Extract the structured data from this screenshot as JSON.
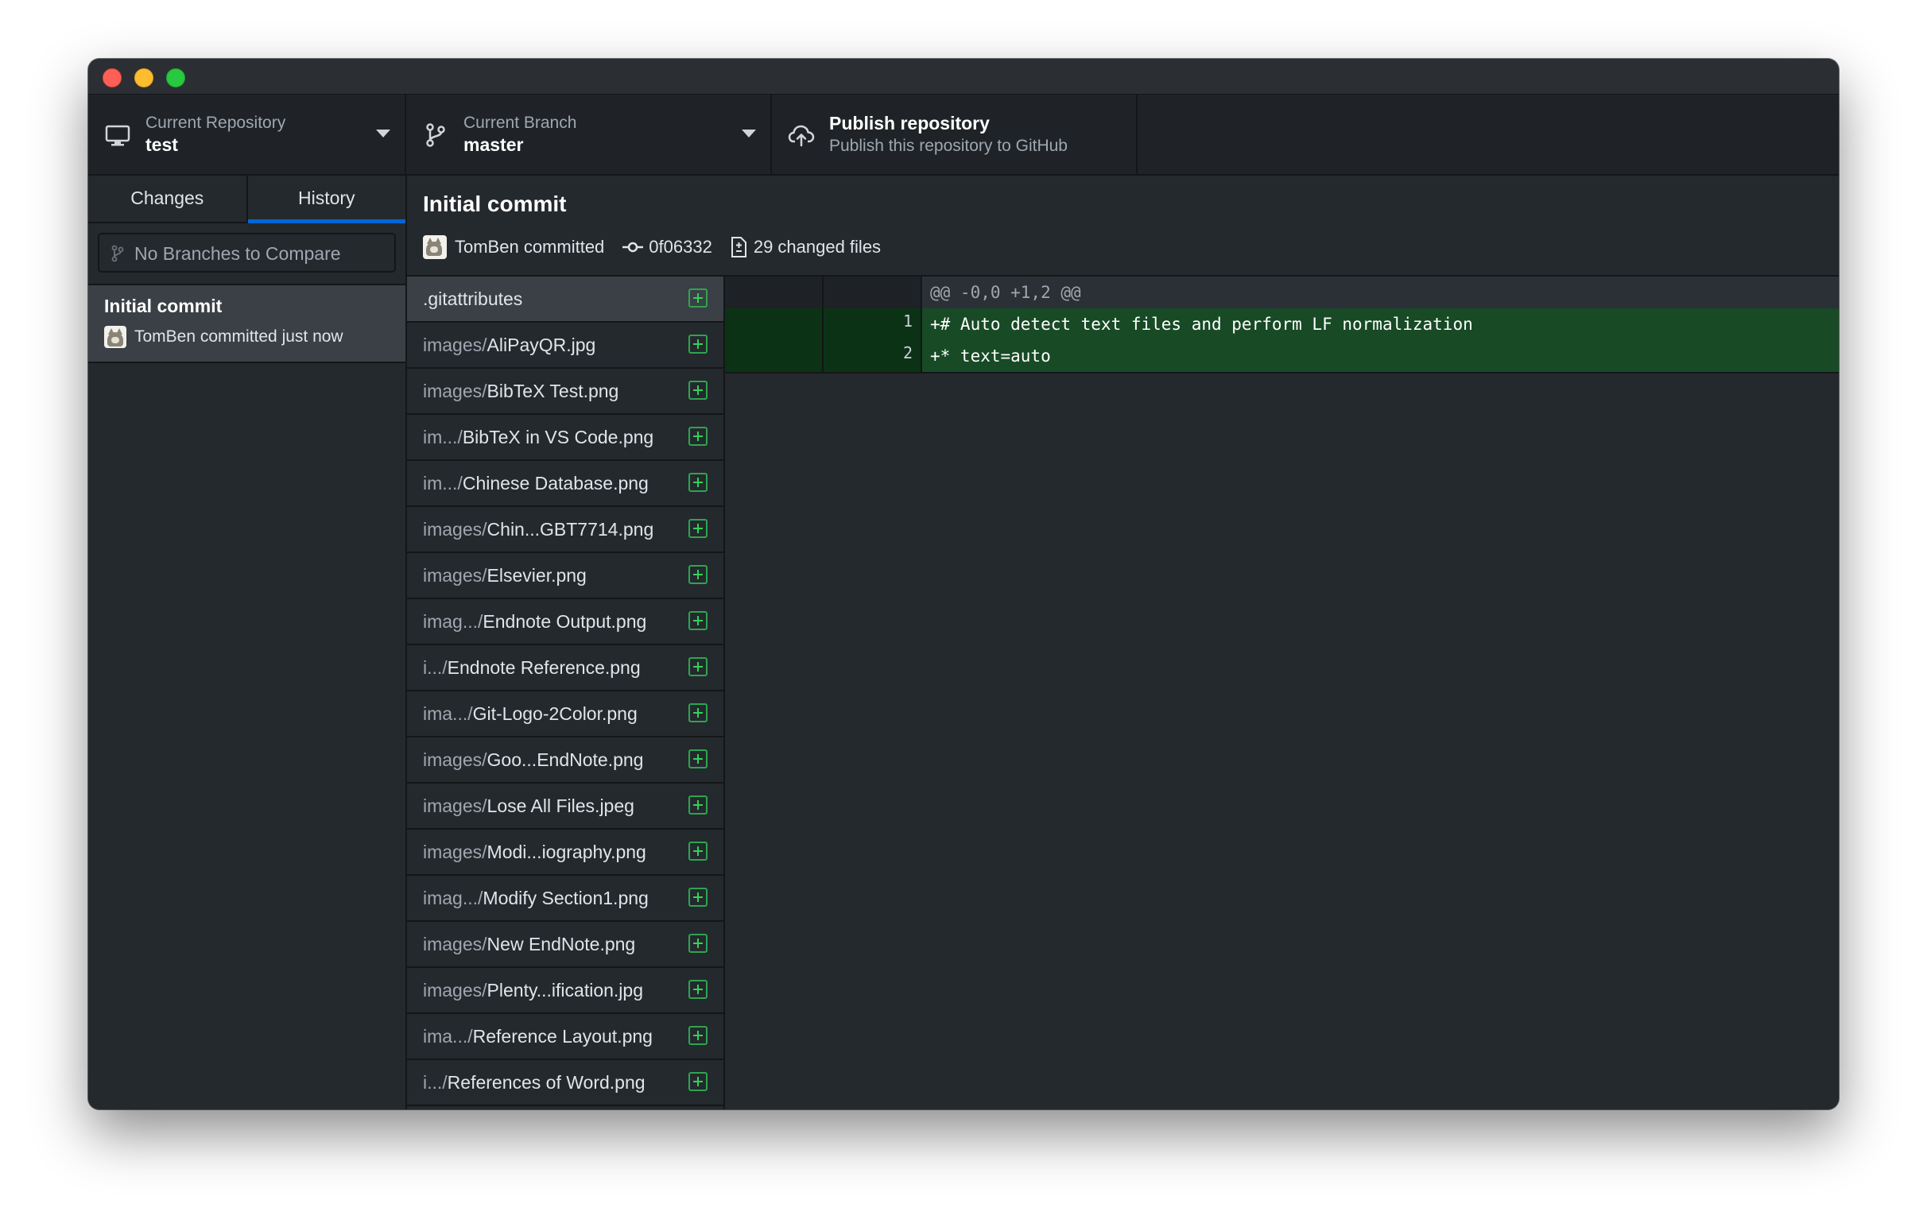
{
  "toolbar": {
    "repository": {
      "caption": "Current Repository",
      "value": "test",
      "icon": "desktop-computer-icon"
    },
    "branch": {
      "caption": "Current Branch",
      "value": "master",
      "icon": "git-branch-icon"
    },
    "publish": {
      "title": "Publish repository",
      "subtitle": "Publish this repository to GitHub",
      "icon": "cloud-upload-icon"
    }
  },
  "sidebar": {
    "tabs": [
      {
        "label": "Changes",
        "active": false
      },
      {
        "label": "History",
        "active": true
      }
    ],
    "compare_placeholder": "No Branches to Compare",
    "commits": [
      {
        "title": "Initial commit",
        "meta": "TomBen committed just now"
      }
    ]
  },
  "commit": {
    "title": "Initial commit",
    "author_text": "TomBen committed",
    "sha": "0f06332",
    "changed_files": "29 changed files"
  },
  "files": [
    {
      "dir": "",
      "name": ".gitattributes",
      "selected": true
    },
    {
      "dir": "images/",
      "name": "AliPayQR.jpg"
    },
    {
      "dir": "images/",
      "name": "BibTeX Test.png"
    },
    {
      "dir": "im.../",
      "name": "BibTeX in VS Code.png"
    },
    {
      "dir": "im.../",
      "name": "Chinese Database.png"
    },
    {
      "dir": "images/",
      "name": "Chin...GBT7714.png"
    },
    {
      "dir": "images/",
      "name": "Elsevier.png"
    },
    {
      "dir": "imag.../",
      "name": "Endnote Output.png"
    },
    {
      "dir": "i.../",
      "name": "Endnote Reference.png"
    },
    {
      "dir": "ima.../",
      "name": "Git-Logo-2Color.png"
    },
    {
      "dir": "images/",
      "name": "Goo...EndNote.png"
    },
    {
      "dir": "images/",
      "name": "Lose All Files.jpeg"
    },
    {
      "dir": "images/",
      "name": "Modi...iography.png"
    },
    {
      "dir": "imag.../",
      "name": "Modify Section1.png"
    },
    {
      "dir": "images/",
      "name": "New EndNote.png"
    },
    {
      "dir": "images/",
      "name": "Plenty...ification.jpg"
    },
    {
      "dir": "ima.../",
      "name": "Reference Layout.png"
    },
    {
      "dir": "i.../",
      "name": "References of Word.png"
    }
  ],
  "diff": {
    "hunk_header": "@@ -0,0 +1,2 @@",
    "lines": [
      {
        "old": "",
        "new": "1",
        "text": "+# Auto detect text files and perform LF normalization"
      },
      {
        "old": "",
        "new": "2",
        "text": "+* text=auto"
      }
    ]
  },
  "colors": {
    "accent_tab_underline": "#0366d6",
    "added_icon": "#2ea44f",
    "added_line_bg": "#174a25"
  }
}
